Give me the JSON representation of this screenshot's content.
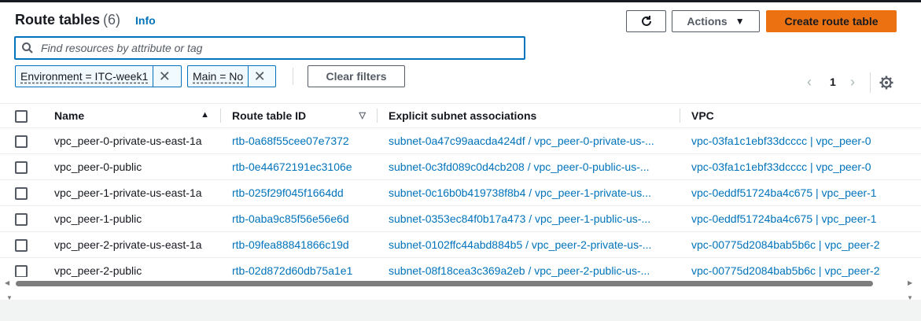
{
  "header": {
    "title": "Route tables",
    "count": "(6)",
    "info_label": "Info",
    "actions_label": "Actions",
    "create_label": "Create route table"
  },
  "search": {
    "placeholder": "Find resources by attribute or tag",
    "value": ""
  },
  "filters": {
    "tokens": [
      {
        "label": "Environment = ITC-week1"
      },
      {
        "label": "Main = No"
      }
    ],
    "clear_label": "Clear filters"
  },
  "pagination": {
    "current_page": "1"
  },
  "table": {
    "columns": [
      "Name",
      "Route table ID",
      "Explicit subnet associations",
      "VPC"
    ],
    "rows": [
      {
        "name": "vpc_peer-0-private-us-east-1a",
        "id": "rtb-0a68f55cee07e7372",
        "subnet": "subnet-0a47c99aacda424df / vpc_peer-0-private-us-...",
        "vpc": "vpc-03fa1c1ebf33dcccc | vpc_peer-0"
      },
      {
        "name": "vpc_peer-0-public",
        "id": "rtb-0e44672191ec3106e",
        "subnet": "subnet-0c3fd089c0d4cb208 / vpc_peer-0-public-us-...",
        "vpc": "vpc-03fa1c1ebf33dcccc | vpc_peer-0"
      },
      {
        "name": "vpc_peer-1-private-us-east-1a",
        "id": "rtb-025f29f045f1664dd",
        "subnet": "subnet-0c16b0b419738f8b4 / vpc_peer-1-private-us...",
        "vpc": "vpc-0eddf51724ba4c675 | vpc_peer-1"
      },
      {
        "name": "vpc_peer-1-public",
        "id": "rtb-0aba9c85f56e56e6d",
        "subnet": "subnet-0353ec84f0b17a473 / vpc_peer-1-public-us-...",
        "vpc": "vpc-0eddf51724ba4c675 | vpc_peer-1"
      },
      {
        "name": "vpc_peer-2-private-us-east-1a",
        "id": "rtb-09fea88841866c19d",
        "subnet": "subnet-0102ffc44abd884b5 / vpc_peer-2-private-us-...",
        "vpc": "vpc-00775d2084bab5b6c | vpc_peer-2"
      },
      {
        "name": "vpc_peer-2-public",
        "id": "rtb-02d872d60db75a1e1",
        "subnet": "subnet-08f18cea3c369a2eb / vpc_peer-2-public-us-...",
        "vpc": "vpc-00775d2084bab5b6c | vpc_peer-2"
      }
    ]
  },
  "icons": {
    "search": "search-icon",
    "refresh": "refresh-icon",
    "settings": "gear-icon",
    "prev": "chevron-left-icon",
    "next": "chevron-right-icon",
    "remove": "close-icon"
  },
  "colors": {
    "accent": "#0073bb",
    "primary_button": "#ec7211",
    "text": "#16191f"
  }
}
